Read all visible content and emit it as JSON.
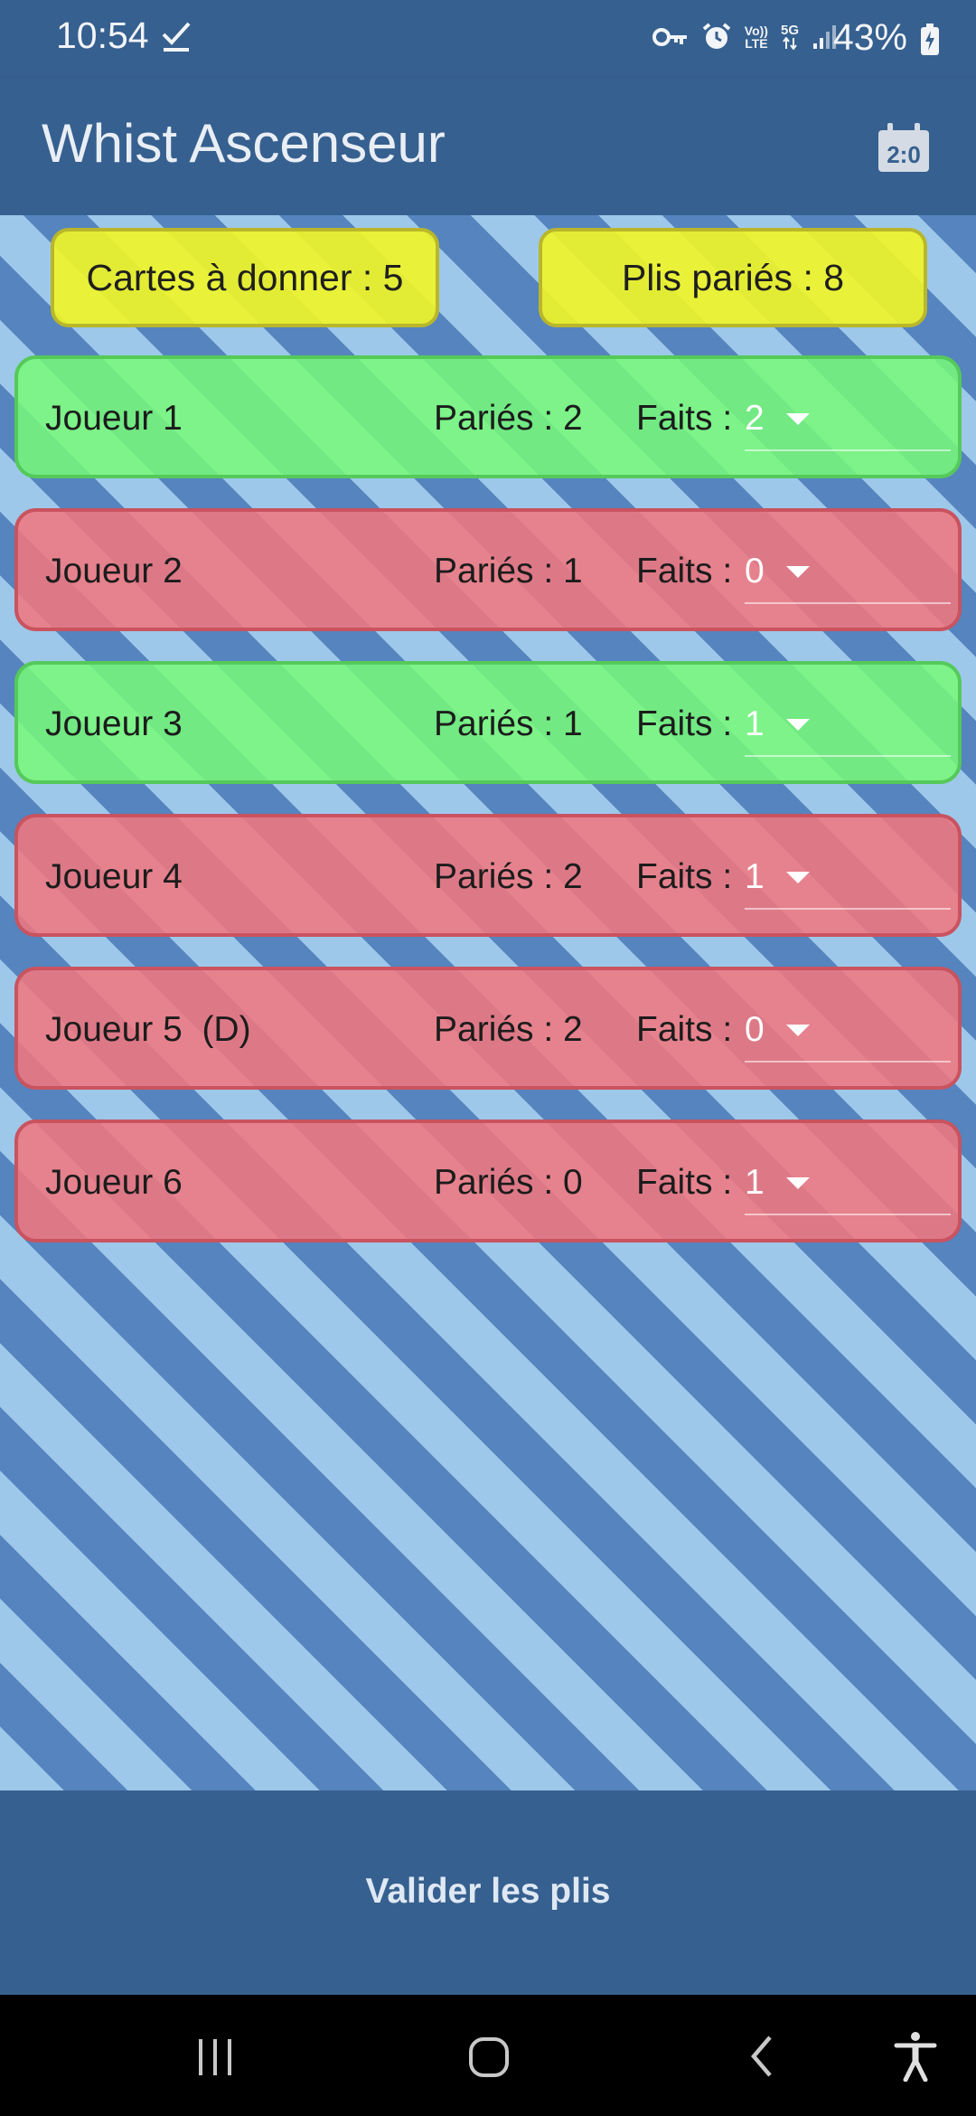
{
  "status_bar": {
    "time": "10:54",
    "battery_percent": "43%",
    "icons": [
      "check-icon",
      "key-icon",
      "alarm-icon",
      "volte-icon",
      "5g-icon",
      "signal-icon",
      "battery-charging-icon"
    ],
    "volte_label_top": "Vo))",
    "volte_label_bottom": "LTE",
    "network_label": "5G"
  },
  "app_bar": {
    "title": "Whist Ascenseur",
    "action_icon": "calendar-icon"
  },
  "summary": {
    "cards_to_deal": "Cartes à donner : 5",
    "tricks_bet": "Plis pariés : 8"
  },
  "players": [
    {
      "name": "Joueur 1",
      "bet": "Pariés : 2",
      "done_label": "Faits :",
      "done_value": "2",
      "status": "ok"
    },
    {
      "name": "Joueur 2",
      "bet": "Pariés : 1",
      "done_label": "Faits :",
      "done_value": "0",
      "status": "ko"
    },
    {
      "name": "Joueur 3",
      "bet": "Pariés : 1",
      "done_label": "Faits :",
      "done_value": "1",
      "status": "ok"
    },
    {
      "name": "Joueur 4",
      "bet": "Pariés : 2",
      "done_label": "Faits :",
      "done_value": "1",
      "status": "ko"
    },
    {
      "name": "Joueur 5  (D)",
      "bet": "Pariés : 2",
      "done_label": "Faits :",
      "done_value": "0",
      "status": "ko"
    },
    {
      "name": "Joueur 6",
      "bet": "Pariés : 0",
      "done_label": "Faits :",
      "done_value": "1",
      "status": "ko"
    }
  ],
  "actions": {
    "validate": "Valider les plis"
  },
  "nav_bar": {
    "items": [
      "recents-icon",
      "home-icon",
      "back-icon",
      "accessibility-icon"
    ]
  },
  "colors": {
    "primary": "#36608f",
    "stripe_light": "#9dc8ea",
    "stripe_dark": "#5584bf",
    "chip_yellow": "#f0f528",
    "row_ok": "#78fa78",
    "row_ko": "#f07880"
  }
}
